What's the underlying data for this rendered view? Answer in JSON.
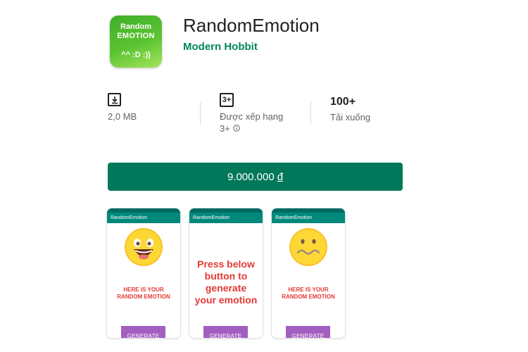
{
  "app": {
    "icon": {
      "line1": "Random",
      "line2": "EMOTION",
      "line3": "^^ :D :))"
    },
    "title": "RandomEmotion",
    "developer": "Modern Hobbit"
  },
  "stats": [
    {
      "icon": "download-icon",
      "label": "2,0 MB"
    },
    {
      "icon": "age-rating-3plus-icon",
      "badge": "3+",
      "label": "Được xếp hạng",
      "sublabel": "3+"
    },
    {
      "value": "100+",
      "label": "Tải xuống"
    }
  ],
  "buy_button": {
    "amount": "9.000.000",
    "currency": "đ"
  },
  "screenshots": [
    {
      "app_bar": "RandomEmotion",
      "face": "laughing",
      "caption_line1": "HERE IS YOUR",
      "caption_line2": "RANDOM EMOTION",
      "button": "GENERATE"
    },
    {
      "app_bar": "RandomEmotion",
      "prompt_lines": [
        "Press below",
        "button to",
        "generate",
        "your emotion"
      ],
      "button": "GENERATE"
    },
    {
      "app_bar": "RandomEmotion",
      "face": "confused",
      "caption_line1": "HERE IS YOUR",
      "caption_line2": "RANDOM EMOTION",
      "button": "GENERATE"
    }
  ],
  "colors": {
    "accent": "#01875f",
    "buy_button": "#01785a",
    "app_bar": "#00897b",
    "generate_button": "#a35fc0",
    "caption_red": "#e53935"
  }
}
